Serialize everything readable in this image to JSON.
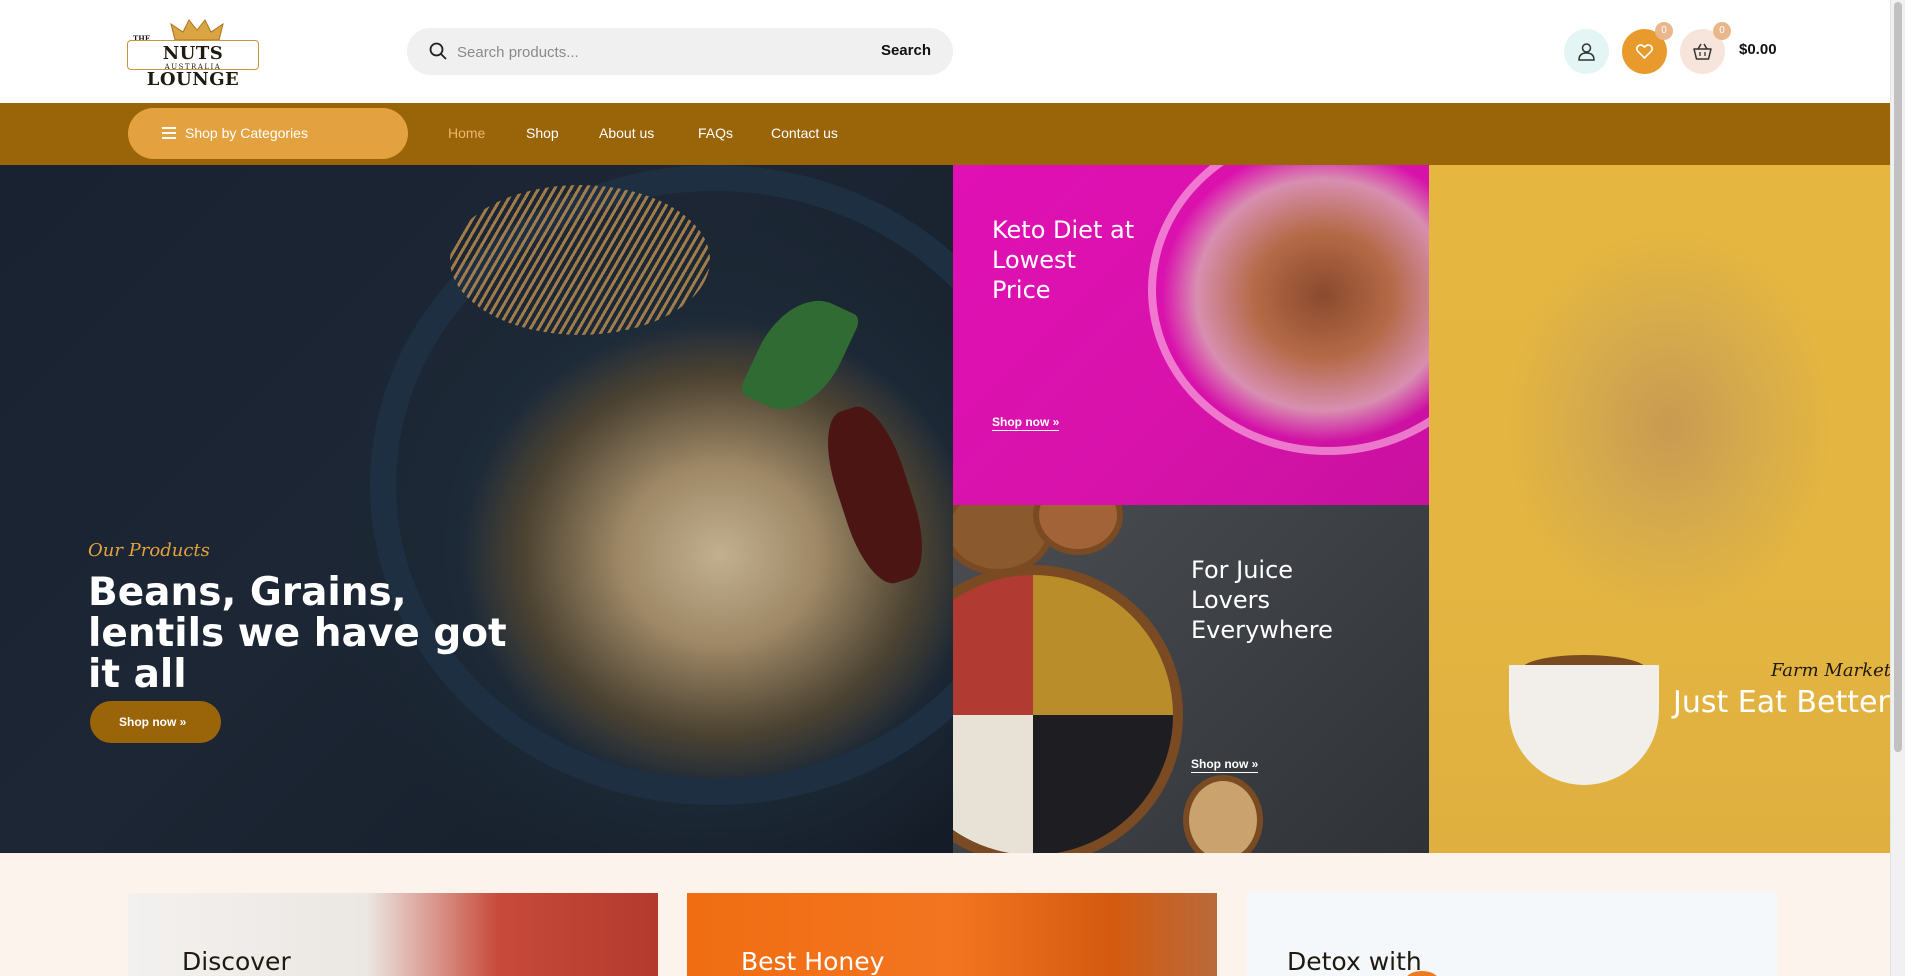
{
  "header": {
    "logo": {
      "the": "THE",
      "name": "NUTS LOUNGE",
      "country": "AUSTRALIA"
    },
    "search": {
      "placeholder": "Search products...",
      "button_label": "Search"
    },
    "wishlist_count": "0",
    "cart_count": "0",
    "cart_total": "$0.00"
  },
  "nav": {
    "categories_label": "Shop by Categories",
    "links": [
      {
        "label": "Home",
        "active": true
      },
      {
        "label": "Shop"
      },
      {
        "label": "About us"
      },
      {
        "label": "FAQs"
      },
      {
        "label": "Contact us"
      }
    ]
  },
  "hero": {
    "eyebrow": "Our Products",
    "title": "Beans, Grains, lentils we have got it all",
    "button_label": "Shop now »"
  },
  "promos": [
    {
      "title": "Keto Diet at Lowest Price",
      "link": "Shop now »"
    },
    {
      "title": "For Juice Lovers Everywhere",
      "link": "Shop now »"
    },
    {
      "eyebrow": "Farm Market",
      "title": "Just Eat Better"
    }
  ],
  "cards": [
    {
      "title": "Discover"
    },
    {
      "title": "Best Honey"
    },
    {
      "title": "Detox with"
    }
  ],
  "colors": {
    "brand_brown": "#9a6408",
    "accent_orange": "#e3a23f",
    "promo_pink": "#e010b4",
    "promo_gray": "#3d4045",
    "promo_yellow": "#e4b541"
  }
}
